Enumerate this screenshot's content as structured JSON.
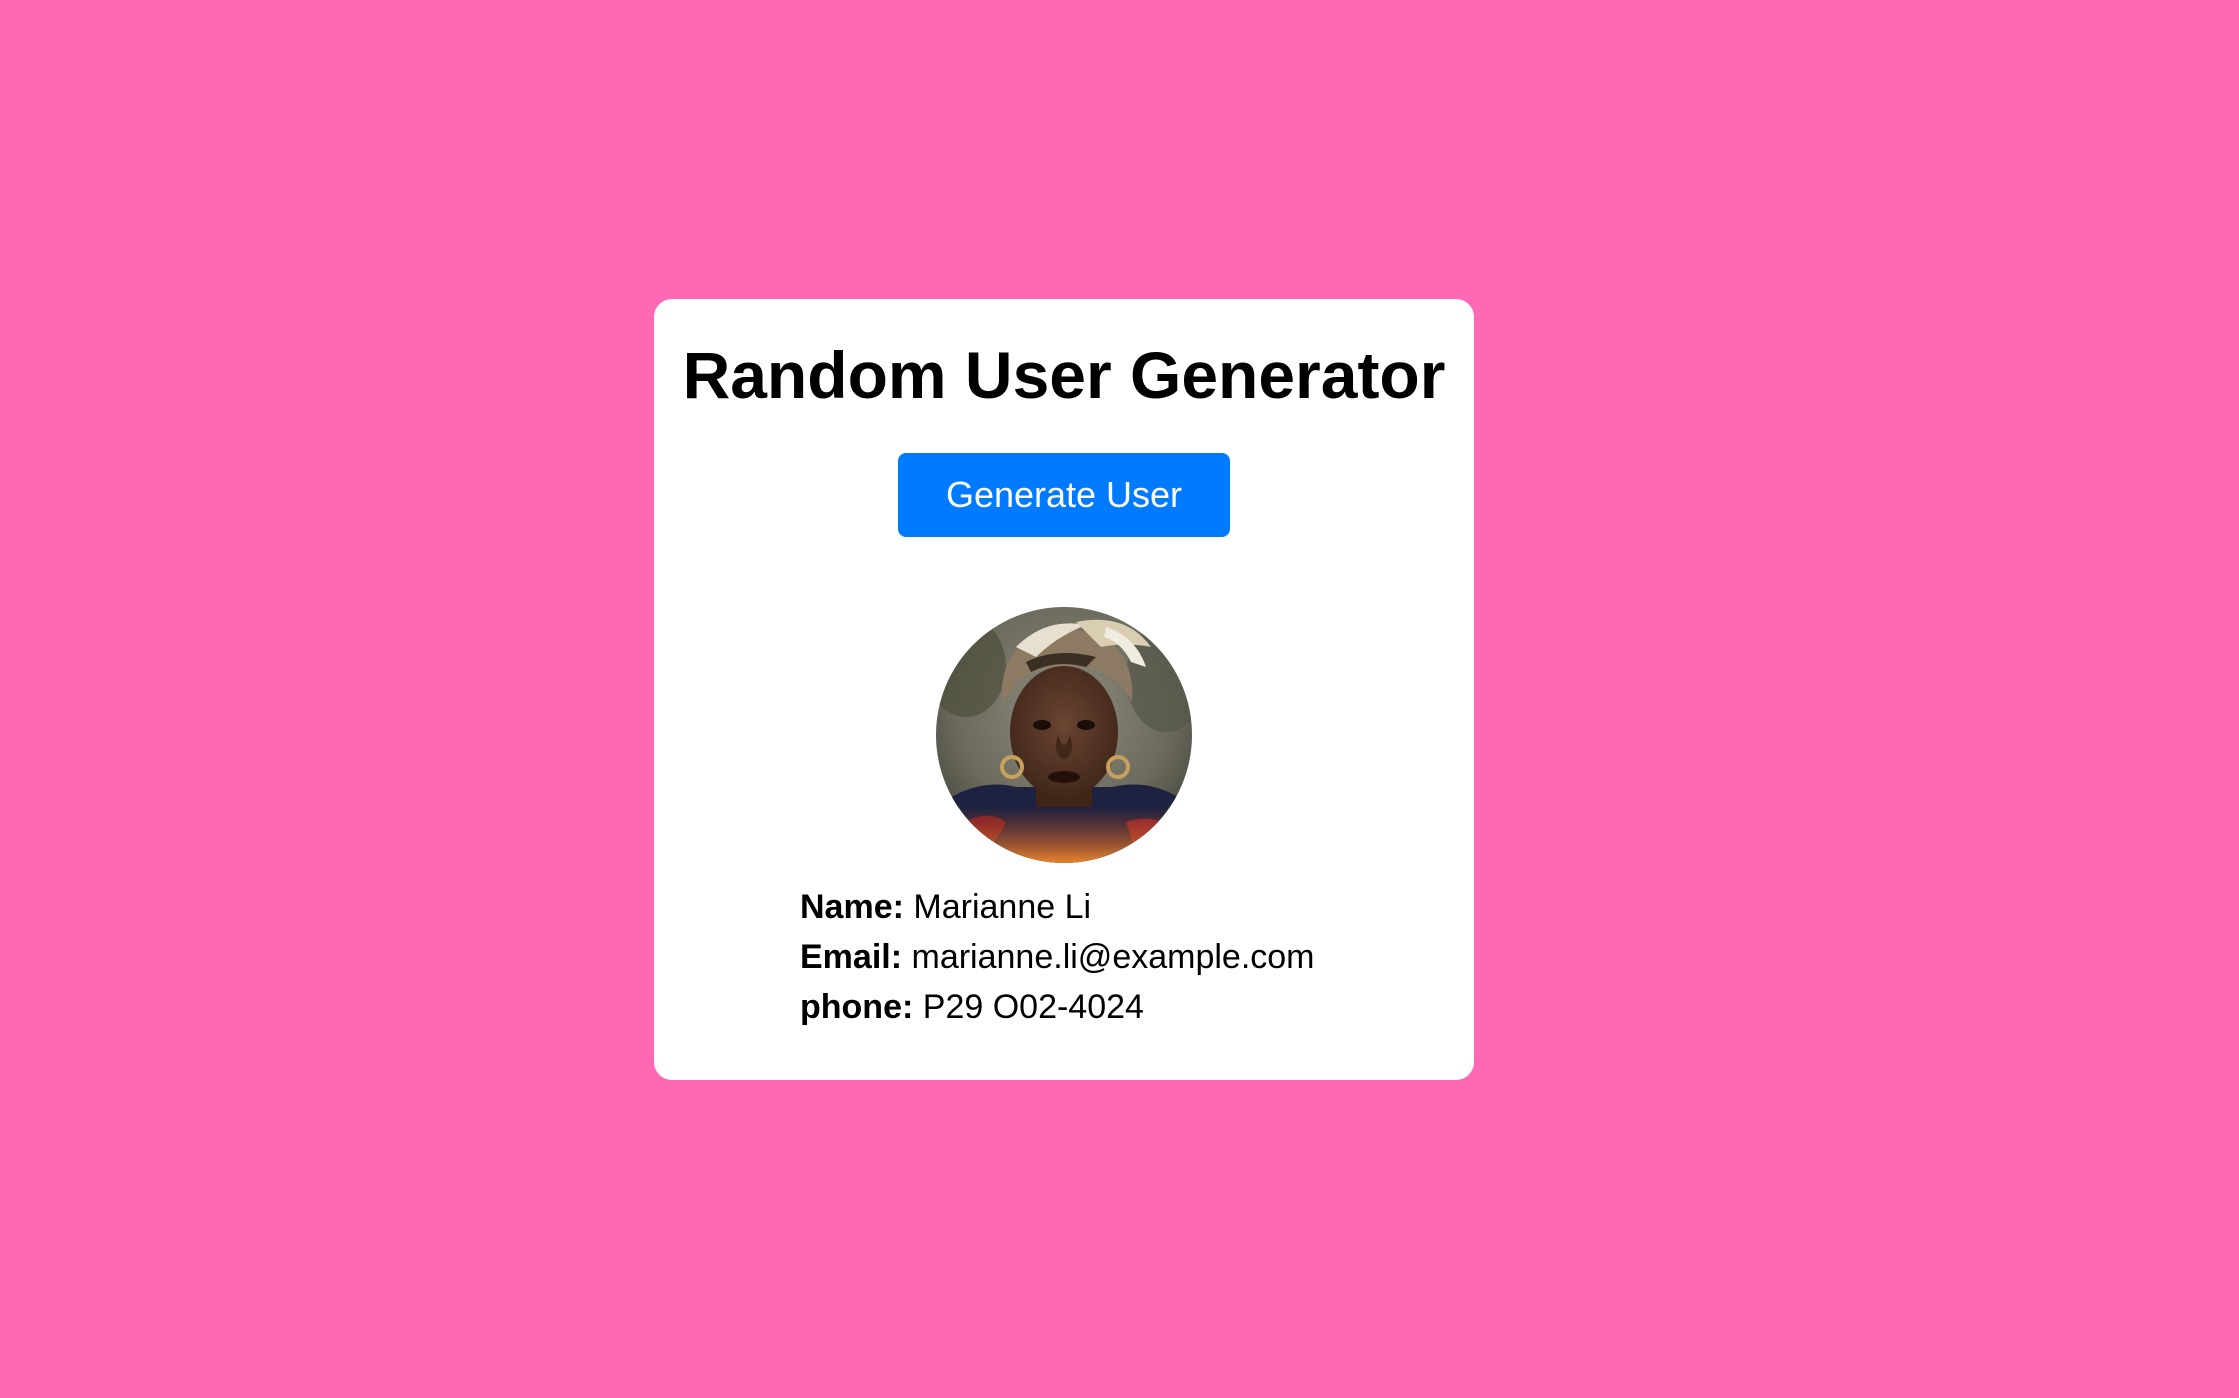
{
  "app": {
    "title": "Random User Generator",
    "background_color": "#ff69b4",
    "accent_color": "#007bff"
  },
  "actions": {
    "generate_label": "Generate User"
  },
  "user": {
    "avatar_icon": "user-portrait-photo",
    "name_label": "Name:",
    "name": "Marianne Li",
    "email_label": "Email:",
    "email": "marianne.li@example.com",
    "phone_label": "phone:",
    "phone": "P29 O02-4024"
  }
}
